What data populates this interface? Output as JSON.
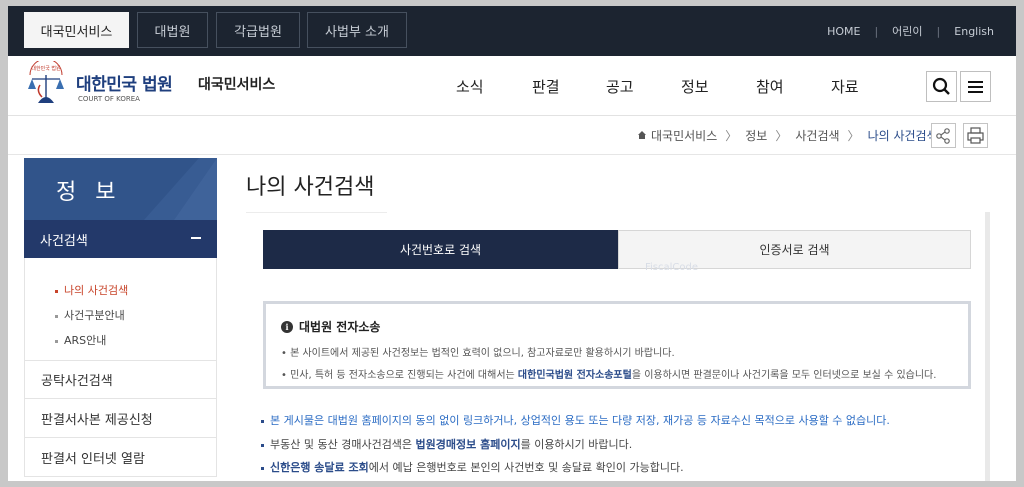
{
  "top_tabs": [
    {
      "label": "대국민서비스",
      "active": true
    },
    {
      "label": "대법원",
      "active": false
    },
    {
      "label": "각급법원",
      "active": false
    },
    {
      "label": "사법부 소개",
      "active": false
    }
  ],
  "top_links": [
    "HOME",
    "어린이",
    "English"
  ],
  "logo": {
    "emblem_text": "대한민국 법원",
    "title": "대한민국 법원",
    "subtitle": "COURT OF KOREA",
    "service": "대국민서비스"
  },
  "gnav": [
    "소식",
    "판결",
    "공고",
    "정보",
    "참여",
    "자료"
  ],
  "breadcrumb": [
    "대국민서비스",
    "정보",
    "사건검색",
    "나의 사건검색"
  ],
  "sidebar": {
    "heading": "정 보",
    "active_section": "사건검색",
    "sub_items": [
      "나의 사건검색",
      "사건구분안내",
      "ARS안내"
    ],
    "items": [
      "공탁사건검색",
      "판결서사본 제공신청",
      "판결서 인터넷 열람"
    ]
  },
  "page_title": "나의 사건검색",
  "tabs": [
    "사건번호로 검색",
    "인증서로 검색"
  ],
  "watermark": "FiscalCode",
  "notice": {
    "title": "대법원 전자소송",
    "line1": "본 사이트에서 제공된 사건정보는 법적인 효력이 없으니, 참고자료로만 활용하시기 바랍니다.",
    "line2_pre": "민사, 특허 등 전자소송으로 진행되는 사건에 대해서는 ",
    "line2_link": "대한민국법원 전자소송포털",
    "line2_post": "을 이용하시면 판결문이나 사건기록을 모두 인터넷으로 보실 수 있습니다."
  },
  "bullets": {
    "b1": "본 게시물은 대법원 홈페이지의 동의 없이 링크하거나, 상업적인 용도 또는 다량 저장, 재가공 등 자료수신 목적으로 사용할 수 없습니다.",
    "b2_pre": "부동산 및 동산 경매사건검색은 ",
    "b2_link": "법원경매정보 홈페이지",
    "b2_post": "를 이용하시기 바랍니다.",
    "b3_link": "신한은행 송달료 조회",
    "b3_post": "에서 예납 은행번호로 본인의 사건번호 및 송달료 확인이 가능합니다."
  },
  "colors": {
    "topbar": "#1c2430",
    "sidebar_head": "#31548a",
    "sidebar_active": "#23396a",
    "tab_active": "#1d2a47",
    "accent_link": "#2b4c8a"
  }
}
